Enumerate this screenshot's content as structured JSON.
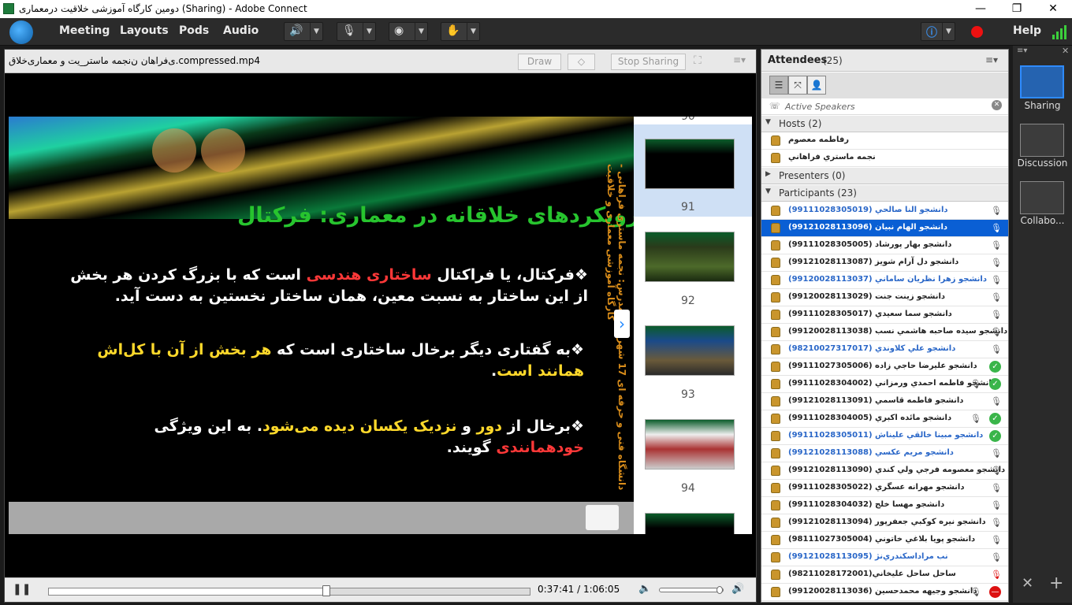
{
  "window": {
    "title": "دومین کارگاه آموزشی خلاقیت درمعماری (Sharing) - Adobe Connect",
    "minimize": "—",
    "maximize": "❐",
    "close": "✕"
  },
  "menu": {
    "items": [
      "Meeting",
      "Layouts",
      "Pods",
      "Audio"
    ],
    "help": "Help"
  },
  "share_pod": {
    "filename": "ی‌فراهان ن‌نجمه ماستر_یت و معماری‌خلاق.compressed.mp4",
    "draw_label": "Draw",
    "stop_sharing_label": "Stop Sharing"
  },
  "slide": {
    "title": "رویکردهای خلاقانه در معماری: فرکتال",
    "p1_a": "❖فرکتال، یا فراکتال ",
    "p1_red": "ساختاری هندسی",
    "p1_b": " است که با بزرگ کردن هر بخش از این ساختار به نسبت معین، همان ساختار نخستین به دست آید.",
    "p2_a": "❖به گفتاری دیگر برخال ساختاری است که ",
    "p2_yellow": "هر بخش از آن با کل‌اش همانند است",
    "p2_b": ".",
    "p3_a": "❖برخال از ",
    "p3_y1": "دور",
    "p3_mid": " و ",
    "p3_y2": "نزدیک یکسان دیده می‌شود",
    "p3_b": ". به این ویژگی ",
    "p3_red": "خودهمانندی",
    "p3_c": " گویند.",
    "vertical_text": "دانشگاه فنی و حرفه ای 17 شهریور - مدرس: نجمه ماستری فراهانی - کارگاه آموزشی معماری و خلاقیت"
  },
  "filmstrip": {
    "pages": [
      "91",
      "92",
      "93",
      "94"
    ],
    "prev": "90"
  },
  "player": {
    "current_time": "0:37:41",
    "total_time": "1:06:05",
    "progress": 0.577,
    "volume": 0.95
  },
  "attendees": {
    "title": "Attendees",
    "count": "(25)",
    "active_speakers": "Active Speakers",
    "hosts_label": "Hosts (2)",
    "presenters_label": "Presenters (0)",
    "participants_label": "Participants (23)",
    "hosts": [
      "رفاطمه معصوم",
      "نجمه ماستري فراهاني"
    ],
    "participants": [
      {
        "name": "دانشجو النا صالحي (99111028305019)",
        "blue": true,
        "status": ""
      },
      {
        "name": "دانشجو الهام نبيان (99121028113096)",
        "blue": true,
        "status": "",
        "selected": true
      },
      {
        "name": "دانشجو بهار پورشاد (99111028305005)",
        "blue": false,
        "status": ""
      },
      {
        "name": "دانشجو دل آرام شويز (99121028113087)",
        "blue": false,
        "status": ""
      },
      {
        "name": "دانشجو زهرا نظريان ساماني (99120028113037)",
        "blue": true,
        "status": ""
      },
      {
        "name": "دانشجو زينت جنت (99120028113029)",
        "blue": false,
        "status": ""
      },
      {
        "name": "دانشجو سما سعيدي (99111028305017)",
        "blue": false,
        "status": ""
      },
      {
        "name": "دانشجو سيده صاحبه هاشمي نسب (99120028113038)",
        "blue": false,
        "status": ""
      },
      {
        "name": "دانشجو علي كلاوندي (98210027317017)",
        "blue": true,
        "status": ""
      },
      {
        "name": "دانشجو عليرضا حاجي زاده (99111027305006)",
        "blue": false,
        "status": "ok"
      },
      {
        "name": "دانشجو فاطمه احمدي ورمزاني (99111028304002)",
        "blue": false,
        "status": "ok"
      },
      {
        "name": "دانشجو فاطمه قاسمي (99121028113091)",
        "blue": false,
        "status": ""
      },
      {
        "name": "دانشجو مائده اكبري (99111028304005)",
        "blue": false,
        "status": "ok"
      },
      {
        "name": "دانشجو مبينا خالقي عليناش (99111028305011)",
        "blue": true,
        "status": "ok"
      },
      {
        "name": "دانشجو مريم عكسي (99121028113088)",
        "blue": true,
        "status": ""
      },
      {
        "name": "دانشجو معصومه فرجي ولي كندي (99121028113090)",
        "blue": false,
        "status": ""
      },
      {
        "name": "دانشجو مهرانه عسگري (99111028305022)",
        "blue": false,
        "status": ""
      },
      {
        "name": "دانشجو مهسا خلج (99111028304032)",
        "blue": false,
        "status": ""
      },
      {
        "name": "دانشجو نيره كوكبي جعفرپور (99121028113094)",
        "blue": false,
        "status": ""
      },
      {
        "name": "دانشجو پويا بلاغي خاتوني (98111027305004)",
        "blue": false,
        "status": ""
      },
      {
        "name": "نب مراداسكندري‌نژ (99121028113095)",
        "blue": true,
        "status": ""
      },
      {
        "name": "ساحل ساحل عليخاني(98211028172001)",
        "blue": false,
        "status": "mute"
      },
      {
        "name": "دانشجو وجيهه محمدحسين (99120028113036)",
        "blue": false,
        "status": "no"
      }
    ]
  },
  "layouts": {
    "items": [
      "Sharing",
      "Discussion",
      "Collabo..."
    ]
  },
  "colors": {
    "accent": "#0a5fd4",
    "ok": "#3ab54a",
    "record": "#e11"
  }
}
